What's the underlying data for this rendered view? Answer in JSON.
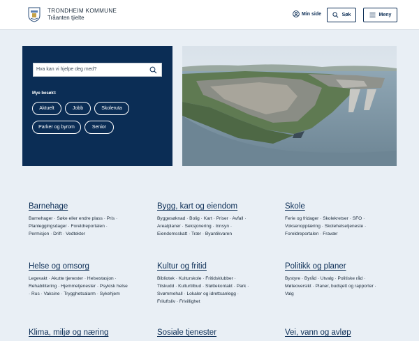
{
  "header": {
    "org_name": "TRONDHEIM KOMMUNE",
    "org_sub": "Tråanten tjielte",
    "min_side": "Min side",
    "search_button": "Søk",
    "menu_button": "Meny"
  },
  "hero": {
    "search_placeholder": "Hva kan vi hjelpe deg med?",
    "most_visited_label": "Mye besøkt:",
    "chips": [
      "Aktuelt",
      "Jobb",
      "Skoleruta",
      "Parker og byrom",
      "Senior"
    ]
  },
  "categories": [
    {
      "title": "Barnehage",
      "lines": [
        "Barnehager · Søke eller endre plass · Pris ·",
        "Planleggingsdager · Foreldreportalen ·",
        "Permisjon · Drift · Vedtekter"
      ]
    },
    {
      "title": "Bygg, kart og eiendom",
      "lines": [
        "Byggesøknad · Bolig · Kart · Priser · Avfall ·",
        "Arealplaner · Seksjonering · Innsyn ·",
        "Eiendomsskatt · Trær · Byantikvaren"
      ]
    },
    {
      "title": "Skole",
      "lines": [
        "Ferie og fridager · Skolekretser · SFO ·",
        "Voksenopplæring · Skolehelsetjeneste ·",
        "Foreldreportalen · Fravær"
      ]
    },
    {
      "title": "Helse og omsorg",
      "lines": [
        "Legevakt · Akutte tjenester · Helsestasjon ·",
        "Rehabilitering · Hjemmetjenester · Psykisk helse",
        "· Rus · Vaksine · Trygghetsalarm · Sykehjem"
      ]
    },
    {
      "title": "Kultur og fritid",
      "lines": [
        "Bibliotek · Kulturskole · Fritidsklubber ·",
        "Tilskudd · Kulturtilbud · Støttekontakt · Park ·",
        "Svømmehall · Lokaler og idrettsanlegg ·",
        "Friluftsliv · Frivillighet"
      ]
    },
    {
      "title": "Politikk og planer",
      "lines": [
        "Bystyre · Byråd · Utvalg · Politiske råd ·",
        "Møteoversikt · Planer, budsjett og rapporter ·",
        "Valg"
      ]
    },
    {
      "title": "Klima, miljø og næring",
      "lines": []
    },
    {
      "title": "Sosiale tjenester",
      "lines": []
    },
    {
      "title": "Vei, vann og avløp",
      "lines": []
    }
  ],
  "colors": {
    "navy": "#0b2d55",
    "background": "#e9eff5"
  }
}
